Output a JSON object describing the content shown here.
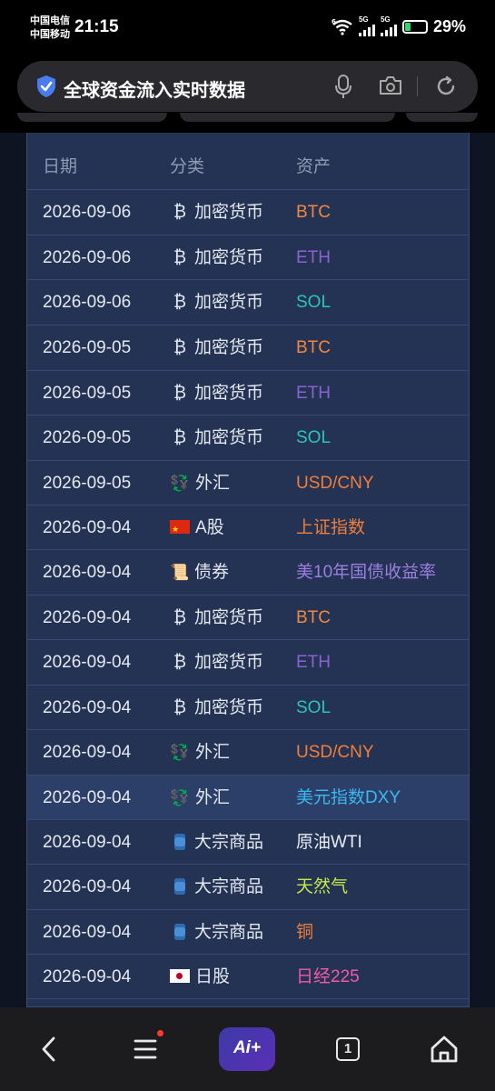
{
  "status": {
    "carrier1": "中国电信",
    "carrier2": "中国移动",
    "time": "21:15",
    "network1": "5G",
    "network2": "5G",
    "wifi_badge": "6",
    "battery": "29%",
    "battery_level": 0.29
  },
  "search": {
    "query": "全球资金流入实时数据"
  },
  "table": {
    "headers": [
      "日期",
      "分类",
      "资产"
    ],
    "rows": [
      {
        "date": "2026-09-06",
        "category": "加密货币",
        "icon": "bitcoin-icon",
        "asset": "BTC",
        "color": "#f0883e"
      },
      {
        "date": "2026-09-06",
        "category": "加密货币",
        "icon": "bitcoin-icon",
        "asset": "ETH",
        "color": "#8a63d2"
      },
      {
        "date": "2026-09-06",
        "category": "加密货币",
        "icon": "bitcoin-icon",
        "asset": "SOL",
        "color": "#2ec4b6"
      },
      {
        "date": "2026-09-05",
        "category": "加密货币",
        "icon": "bitcoin-icon",
        "asset": "BTC",
        "color": "#f0883e"
      },
      {
        "date": "2026-09-05",
        "category": "加密货币",
        "icon": "bitcoin-icon",
        "asset": "ETH",
        "color": "#8a63d2"
      },
      {
        "date": "2026-09-05",
        "category": "加密货币",
        "icon": "bitcoin-icon",
        "asset": "SOL",
        "color": "#2ec4b6"
      },
      {
        "date": "2026-09-05",
        "category": "外汇",
        "icon": "currency-exchange-icon",
        "asset": "USD/CNY",
        "color": "#f07f3c"
      },
      {
        "date": "2026-09-04",
        "category": "A股",
        "icon": "china-flag-icon",
        "asset": "上证指数",
        "color": "#f07f3c"
      },
      {
        "date": "2026-09-04",
        "category": "债券",
        "icon": "scroll-icon",
        "asset": "美10年国债收益率",
        "color": "#9b7ee0"
      },
      {
        "date": "2026-09-04",
        "category": "加密货币",
        "icon": "bitcoin-icon",
        "asset": "BTC",
        "color": "#f0883e"
      },
      {
        "date": "2026-09-04",
        "category": "加密货币",
        "icon": "bitcoin-icon",
        "asset": "ETH",
        "color": "#8a63d2"
      },
      {
        "date": "2026-09-04",
        "category": "加密货币",
        "icon": "bitcoin-icon",
        "asset": "SOL",
        "color": "#2ec4b6"
      },
      {
        "date": "2026-09-04",
        "category": "外汇",
        "icon": "currency-exchange-icon",
        "asset": "USD/CNY",
        "color": "#f07f3c"
      },
      {
        "date": "2026-09-04",
        "category": "外汇",
        "icon": "currency-exchange-icon",
        "asset": "美元指数DXY",
        "color": "#3ab8f0",
        "highlight": true
      },
      {
        "date": "2026-09-04",
        "category": "大宗商品",
        "icon": "oil-barrel-icon",
        "asset": "原油WTI",
        "color": "#e8ecf5"
      },
      {
        "date": "2026-09-04",
        "category": "大宗商品",
        "icon": "oil-barrel-icon",
        "asset": "天然气",
        "color": "#c6e84a"
      },
      {
        "date": "2026-09-04",
        "category": "大宗商品",
        "icon": "oil-barrel-icon",
        "asset": "铜",
        "color": "#f07f3c"
      },
      {
        "date": "2026-09-04",
        "category": "日股",
        "icon": "japan-flag-icon",
        "asset": "日经225",
        "color": "#f05aa8"
      }
    ]
  },
  "nav": {
    "ai_label": "Ai+",
    "tab_count": "1"
  }
}
